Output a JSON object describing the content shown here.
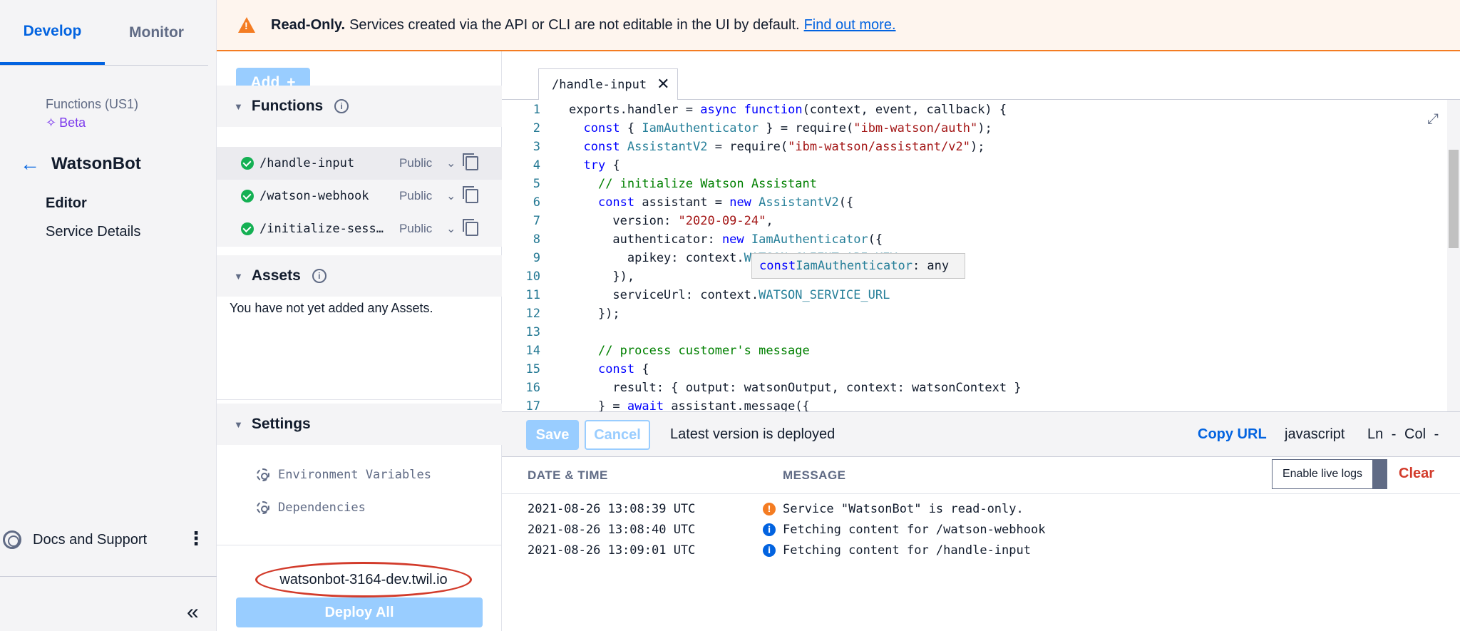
{
  "sidebar": {
    "tabs": [
      "Develop",
      "Monitor"
    ],
    "service_subtitle": "Functions (US1)",
    "beta_label": "Beta",
    "service_name": "WatsonBot",
    "nav": {
      "editor": "Editor",
      "service_details": "Service Details"
    },
    "docs_label": "Docs and Support",
    "collapse_glyph": "«"
  },
  "banner": {
    "bold": "Read-Only.",
    "text": "Services created via the API or CLI are not editable in the UI by default.",
    "link": "Find out more."
  },
  "middle": {
    "add_label": "Add",
    "functions_title": "Functions",
    "functions": [
      {
        "path": "/handle-input",
        "visibility": "Public"
      },
      {
        "path": "/watson-webhook",
        "visibility": "Public"
      },
      {
        "path": "/initialize-sess…",
        "visibility": "Public"
      }
    ],
    "assets_title": "Assets",
    "assets_empty": "You have not yet added any Assets.",
    "settings_title": "Settings",
    "settings_items": [
      "Environment Variables",
      "Dependencies"
    ],
    "domain": "watsonbot-3164-dev.twil.io",
    "deploy_label": "Deploy All"
  },
  "editor": {
    "tab_label": "/handle-input",
    "tooltip": {
      "keyword": "const",
      "name": "IamAuthenticator",
      "type": ": any"
    },
    "code_lines": [
      "1",
      "2",
      "3",
      "4",
      "5",
      "6",
      "7",
      "8",
      "9",
      "10",
      "11",
      "12",
      "13",
      "14",
      "15",
      "16",
      "17"
    ],
    "save_label": "Save",
    "cancel_label": "Cancel",
    "deploy_status": "Latest version is deployed",
    "copy_url_label": "Copy URL",
    "language": "javascript",
    "cursor": "Ln - Col -"
  },
  "logs": {
    "header_date": "DATE & TIME",
    "header_message": "MESSAGE",
    "live_logs_label": "Enable live logs",
    "clear_label": "Clear",
    "rows": [
      {
        "date": "2021-08-26 13:08:39 UTC",
        "level": "warning",
        "message": "Service \"WatsonBot\" is read-only."
      },
      {
        "date": "2021-08-26 13:08:40 UTC",
        "level": "info",
        "message": "Fetching content for /watson-webhook"
      },
      {
        "date": "2021-08-26 13:09:01 UTC",
        "level": "info",
        "message": "Fetching content for /handle-input"
      }
    ]
  },
  "colors": {
    "accent": "#0263e0",
    "warning": "#f47c22",
    "success": "#14b053",
    "danger": "#d23b2b",
    "disabled_button": "#99cdff"
  }
}
